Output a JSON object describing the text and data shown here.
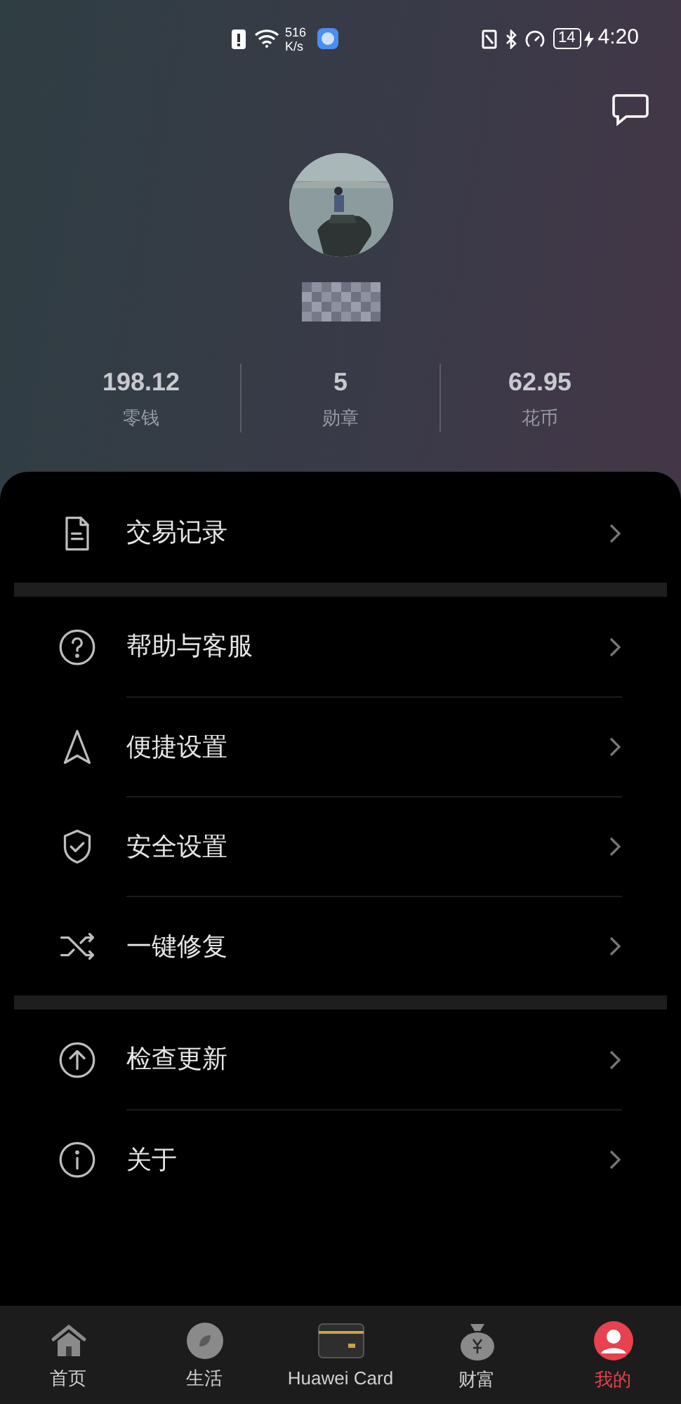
{
  "status_bar": {
    "speed_value": "516",
    "speed_unit": "K/s",
    "battery": "14",
    "time": "4:20"
  },
  "stats": [
    {
      "value": "198.12",
      "label": "零钱"
    },
    {
      "value": "5",
      "label": "勋章"
    },
    {
      "value": "62.95",
      "label": "花币"
    }
  ],
  "menu_groups": [
    [
      {
        "kind": "document",
        "label": "交易记录"
      }
    ],
    [
      {
        "kind": "help",
        "label": "帮助与客服"
      },
      {
        "kind": "navigation",
        "label": "便捷设置"
      },
      {
        "kind": "shield",
        "label": "安全设置"
      },
      {
        "kind": "shuffle",
        "label": "一键修复"
      }
    ],
    [
      {
        "kind": "upload",
        "label": "检查更新"
      },
      {
        "kind": "info",
        "label": "关于"
      }
    ]
  ],
  "tab_bar": [
    {
      "kind": "home",
      "label": "首页",
      "selected": false
    },
    {
      "kind": "compass",
      "label": "生活",
      "selected": false
    },
    {
      "kind": "card",
      "label": "Huawei Card",
      "selected": false
    },
    {
      "kind": "money",
      "label": "财富",
      "selected": false
    },
    {
      "kind": "person",
      "label": "我的",
      "selected": true
    }
  ]
}
